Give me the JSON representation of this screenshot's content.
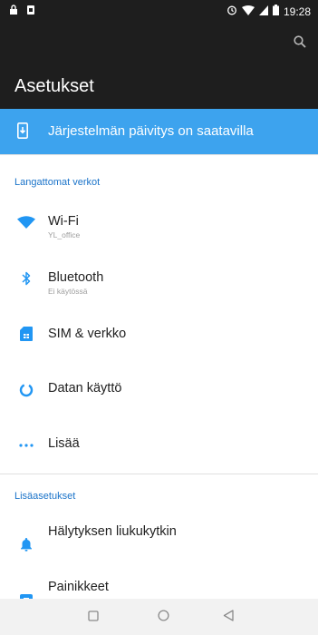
{
  "status_bar": {
    "time": "19:28"
  },
  "header": {
    "title": "Asetukset"
  },
  "update_banner": {
    "label": "Järjestelmän päivitys on saatavilla"
  },
  "sections": {
    "wireless": "Langattomat verkot",
    "additional": "Lisäasetukset"
  },
  "items": {
    "wifi": {
      "label": "Wi-Fi",
      "subtitle": "YL_office"
    },
    "bluetooth": {
      "label": "Bluetooth",
      "subtitle": "Ei käytössä"
    },
    "sim": {
      "label": "SIM & verkko"
    },
    "data": {
      "label": "Datan käyttö"
    },
    "more": {
      "label": "Lisää"
    },
    "alarm": {
      "label": "Hälytyksen liukukytkin"
    },
    "buttons": {
      "label": "Painikkeet"
    }
  },
  "colors": {
    "accent": "#1a73c9",
    "banner": "#3da3ee",
    "appbar": "#1e1e1e",
    "icon_blue": "#2196f3"
  }
}
